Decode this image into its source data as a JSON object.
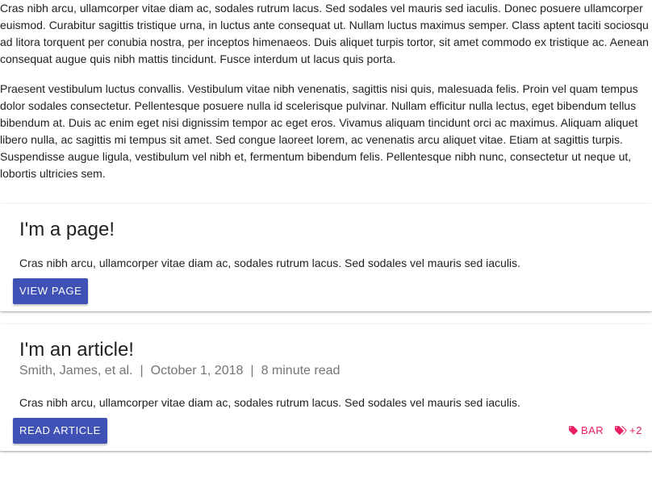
{
  "intro": {
    "paragraphs": [
      "Cras nibh arcu, ullamcorper vitae diam ac, sodales rutrum lacus. Sed sodales vel mauris sed iaculis. Donec posuere ullamcorper euismod. Curabitur sagittis tristique urna, in luctus ante consequat ut. Nullam luctus maximus semper. Class aptent taciti sociosqu ad litora torquent per conubia nostra, per inceptos himenaeos. Duis aliquet turpis tortor, sit amet commodo ex tristique ac. Aenean consequat augue quis nibh mattis tincidunt. Fusce interdum ut lacus quis porta.",
      "Praesent vestibulum luctus convallis. Vestibulum vitae nibh venenatis, sagittis nisi quis, malesuada felis. Proin vel quam tempus dolor sodales consectetur. Pellentesque posuere nulla id scelerisque pulvinar. Nullam efficitur nulla lectus, eget bibendum tellus bibendum at. Duis ac enim eget nisi dignissim tempor ac eget eros. Vivamus aliquam tincidunt orci ac maximus. Aliquam aliquet libero nulla, ac sagittis mi tempus sit amet. Sed congue laoreet lorem, ac venenatis arcu aliquet vitae. Etiam at sagittis turpis. Suspendisse augue ligula, vestibulum vel nibh et, fermentum bibendum felis. Pellentesque nibh nunc, consectetur ut neque ut, lobortis ultricies sem."
    ]
  },
  "page_card": {
    "title": "I'm a page!",
    "excerpt": "Cras nibh arcu, ullamcorper vitae diam ac, sodales rutrum lacus. Sed sodales vel mauris sed iaculis.",
    "button_label": "View page"
  },
  "article_card": {
    "title": "I'm an article!",
    "authors": "Smith, James, et al.",
    "separator": "|",
    "date": "October 1, 2018",
    "read_time": "8 minute read",
    "excerpt": "Cras nibh arcu, ullamcorper vitae diam ac, sodales rutrum lacus. Sed sodales vel mauris sed iaculis.",
    "button_label": "Read article",
    "tags": [
      {
        "label": "BAR",
        "icon": "tag-icon"
      },
      {
        "label": "+2",
        "icon": "tags-icon"
      }
    ]
  },
  "colors": {
    "primary": "#3f51b5",
    "tag_accent": "#e91e63",
    "meta_text": "#757575"
  }
}
